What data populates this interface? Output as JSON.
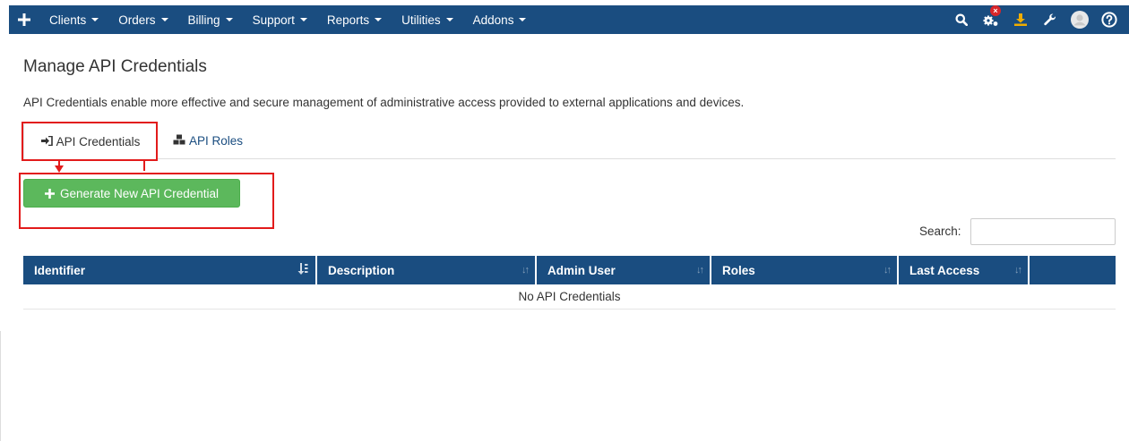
{
  "nav": {
    "menus": [
      {
        "label": "Clients"
      },
      {
        "label": "Orders"
      },
      {
        "label": "Billing"
      },
      {
        "label": "Support"
      },
      {
        "label": "Reports"
      },
      {
        "label": "Utilities"
      },
      {
        "label": "Addons"
      }
    ],
    "icons": [
      "plus-icon",
      "search-icon",
      "cogs-icon",
      "download-icon",
      "wrench-icon",
      "user-avatar-icon",
      "help-icon"
    ],
    "colors": {
      "bar": "#1a4d80",
      "download": "#f0ad00",
      "badge": "#d9262a"
    }
  },
  "page": {
    "title": "Manage API Credentials",
    "intro": "API Credentials enable more effective and secure management of administrative access provided to external applications and devices."
  },
  "tabs": [
    {
      "label": "API Credentials",
      "icon": "sign-in-icon",
      "active": true
    },
    {
      "label": "API Roles",
      "icon": "cubes-icon",
      "active": false
    }
  ],
  "actions": {
    "generate_label": "Generate New API Credential",
    "button_color": "#5cb85c"
  },
  "search": {
    "label": "Search:",
    "value": ""
  },
  "table": {
    "columns": [
      {
        "label": "Identifier",
        "sorted": true
      },
      {
        "label": "Description",
        "sorted": false
      },
      {
        "label": "Admin User",
        "sorted": false
      },
      {
        "label": "Roles",
        "sorted": false
      },
      {
        "label": "Last Access",
        "sorted": false
      },
      {
        "label": "",
        "sorted": false
      }
    ],
    "empty_message": "No API Credentials"
  }
}
